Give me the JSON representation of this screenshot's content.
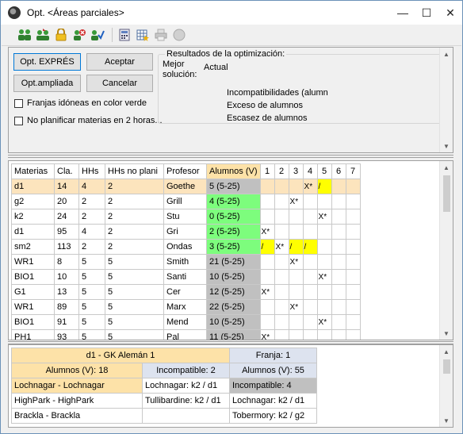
{
  "window": {
    "title": "Opt. <Áreas parciales>"
  },
  "buttons": {
    "express": "Opt. EXPRÉS",
    "accept": "Aceptar",
    "extended": "Opt.ampliada",
    "cancel": "Cancelar"
  },
  "checks": {
    "franjas": "Franjas idóneas en color verde",
    "no_plan": "No planificar materias en 2 horas..."
  },
  "results": {
    "title": "Resultados de la optimización:",
    "best_line1": "Mejor",
    "best_line2": "solución:",
    "current": "Actual",
    "items": [
      "Incompatibilidades (alumn",
      "Exceso de alumnos",
      "Escasez de alumnos"
    ]
  },
  "grid": {
    "headers": [
      "Materias",
      "Cla.",
      "HHs",
      "HHs no plani",
      "Profesor",
      "Alumnos (V)",
      "1",
      "2",
      "3",
      "4",
      "5",
      "6",
      "7"
    ],
    "rows": [
      {
        "m": "d1",
        "c": "14",
        "h": "4",
        "np": "2",
        "p": "Goethe",
        "a": "5 (5-25)",
        "ac": "gray",
        "s": [
          "",
          "",
          "",
          "X*",
          "/",
          "",
          ""
        ],
        "sc": [
          "",
          "",
          "",
          "",
          "yellow",
          "",
          ""
        ],
        "sel": true
      },
      {
        "m": "g2",
        "c": "20",
        "h": "2",
        "np": "2",
        "p": "Grill",
        "a": "4 (5-25)",
        "ac": "green",
        "s": [
          "",
          "",
          "X*",
          "",
          "",
          "",
          ""
        ],
        "sc": [
          "",
          "",
          "",
          "",
          "",
          "",
          ""
        ]
      },
      {
        "m": "k2",
        "c": "24",
        "h": "2",
        "np": "2",
        "p": "Stu",
        "a": "0 (5-25)",
        "ac": "green",
        "s": [
          "",
          "",
          "",
          "",
          "X*",
          "",
          ""
        ],
        "sc": [
          "",
          "",
          "",
          "",
          "",
          "",
          ""
        ]
      },
      {
        "m": "d1",
        "c": "95",
        "h": "4",
        "np": "2",
        "p": "Gri",
        "a": "2 (5-25)",
        "ac": "green",
        "s": [
          "X*",
          "",
          "",
          "",
          "",
          "",
          ""
        ],
        "sc": [
          "",
          "",
          "",
          "",
          "",
          "",
          ""
        ]
      },
      {
        "m": "sm2",
        "c": "113",
        "h": "2",
        "np": "2",
        "p": "Ondas",
        "a": "3 (5-25)",
        "ac": "green",
        "s": [
          "/",
          "X*",
          "/",
          "/",
          "",
          "",
          ""
        ],
        "sc": [
          "yellow",
          "",
          "yellow",
          "yellow",
          "",
          "",
          ""
        ]
      },
      {
        "m": "WR1",
        "c": "8",
        "h": "5",
        "np": "5",
        "p": "Smith",
        "a": "21 (5-25)",
        "ac": "gray",
        "s": [
          "",
          "",
          "X*",
          "",
          "",
          "",
          ""
        ],
        "sc": [
          "",
          "",
          "",
          "",
          "",
          "",
          ""
        ]
      },
      {
        "m": "BIO1",
        "c": "10",
        "h": "5",
        "np": "5",
        "p": "Santi",
        "a": "10 (5-25)",
        "ac": "gray",
        "s": [
          "",
          "",
          "",
          "",
          "X*",
          "",
          ""
        ],
        "sc": [
          "",
          "",
          "",
          "",
          "",
          "",
          ""
        ]
      },
      {
        "m": "G1",
        "c": "13",
        "h": "5",
        "np": "5",
        "p": "Cer",
        "a": "12 (5-25)",
        "ac": "gray",
        "s": [
          "X*",
          "",
          "",
          "",
          "",
          "",
          ""
        ],
        "sc": [
          "",
          "",
          "",
          "",
          "",
          "",
          ""
        ]
      },
      {
        "m": "WR1",
        "c": "89",
        "h": "5",
        "np": "5",
        "p": "Marx",
        "a": "22 (5-25)",
        "ac": "gray",
        "s": [
          "",
          "",
          "X*",
          "",
          "",
          "",
          ""
        ],
        "sc": [
          "",
          "",
          "",
          "",
          "",
          "",
          ""
        ]
      },
      {
        "m": "BIO1",
        "c": "91",
        "h": "5",
        "np": "5",
        "p": "Mend",
        "a": "10 (5-25)",
        "ac": "gray",
        "s": [
          "",
          "",
          "",
          "",
          "X*",
          "",
          ""
        ],
        "sc": [
          "",
          "",
          "",
          "",
          "",
          "",
          ""
        ]
      },
      {
        "m": "PH1",
        "c": "93",
        "h": "5",
        "np": "5",
        "p": "Pal",
        "a": "11 (5-25)",
        "ac": "gray",
        "s": [
          "X*",
          "",
          "",
          "",
          "",
          "",
          ""
        ],
        "sc": [
          "",
          "",
          "",
          "",
          "",
          "",
          ""
        ]
      }
    ]
  },
  "bottom": {
    "subject": "d1 - GK Alemán 1",
    "franja": "Franja: 1",
    "alumnos_left": "Alumnos (V): 18",
    "incompatible_mid": "Incompatible: 2",
    "alumnos_right": "Alumnos (V): 55",
    "r1": [
      "Lochnagar - Lochnagar",
      "Lochnagar: k2 / d1",
      "Incompatible: 4"
    ],
    "r2": [
      "HighPark - HighPark",
      "Tullibardine: k2 / d1",
      "Lochnagar: k2 / d1"
    ],
    "r3": [
      "Brackla - Brackla",
      "",
      "Tobermory: k2 / g2"
    ]
  }
}
